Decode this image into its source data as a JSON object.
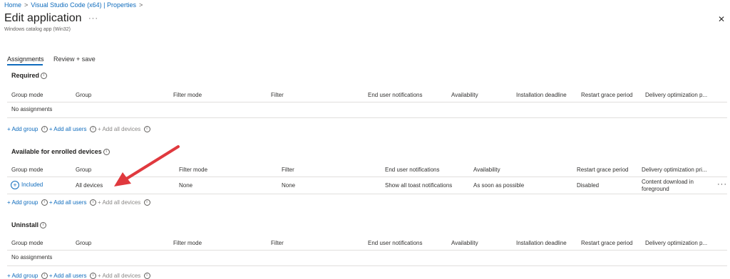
{
  "breadcrumb": {
    "home": "Home",
    "app": "Visual Studio Code (x64) | Properties",
    "sep": ">"
  },
  "header": {
    "title": "Edit application",
    "subtitle": "Windows catalog app (Win32)",
    "more": "···",
    "close": "✕"
  },
  "tabs": [
    {
      "label": "Assignments"
    },
    {
      "label": "Review + save"
    }
  ],
  "required": {
    "title": "Required",
    "columns": [
      "Group mode",
      "Group",
      "Filter mode",
      "Filter",
      "End user notifications",
      "Availability",
      "Installation deadline",
      "Restart grace period",
      "Delivery optimization p..."
    ],
    "empty": "No assignments"
  },
  "available": {
    "title": "Available for enrolled devices",
    "columns": [
      "Group mode",
      "Group",
      "Filter mode",
      "Filter",
      "End user notifications",
      "Availability",
      "Restart grace period",
      "Delivery optimization pri..."
    ],
    "row": {
      "group_mode": "Included",
      "group": "All devices",
      "filter_mode": "None",
      "filter": "None",
      "notifications": "Show all toast notifications",
      "availability": "As soon as possible",
      "restart": "Disabled",
      "delivery_1": "Content download in",
      "delivery_2": "foreground",
      "more": "···"
    }
  },
  "uninstall": {
    "title": "Uninstall",
    "columns": [
      "Group mode",
      "Group",
      "Filter mode",
      "Filter",
      "End user notifications",
      "Availability",
      "Installation deadline",
      "Restart grace period",
      "Delivery optimization p..."
    ],
    "empty": "No assignments"
  },
  "add_links": {
    "add_group": "+ Add group",
    "add_all_users": "+ Add all users",
    "add_all_devices": "+ Add all devices",
    "info": "i"
  },
  "colors": {
    "accent": "#0f6cbd",
    "arrow": "#e0393e"
  }
}
